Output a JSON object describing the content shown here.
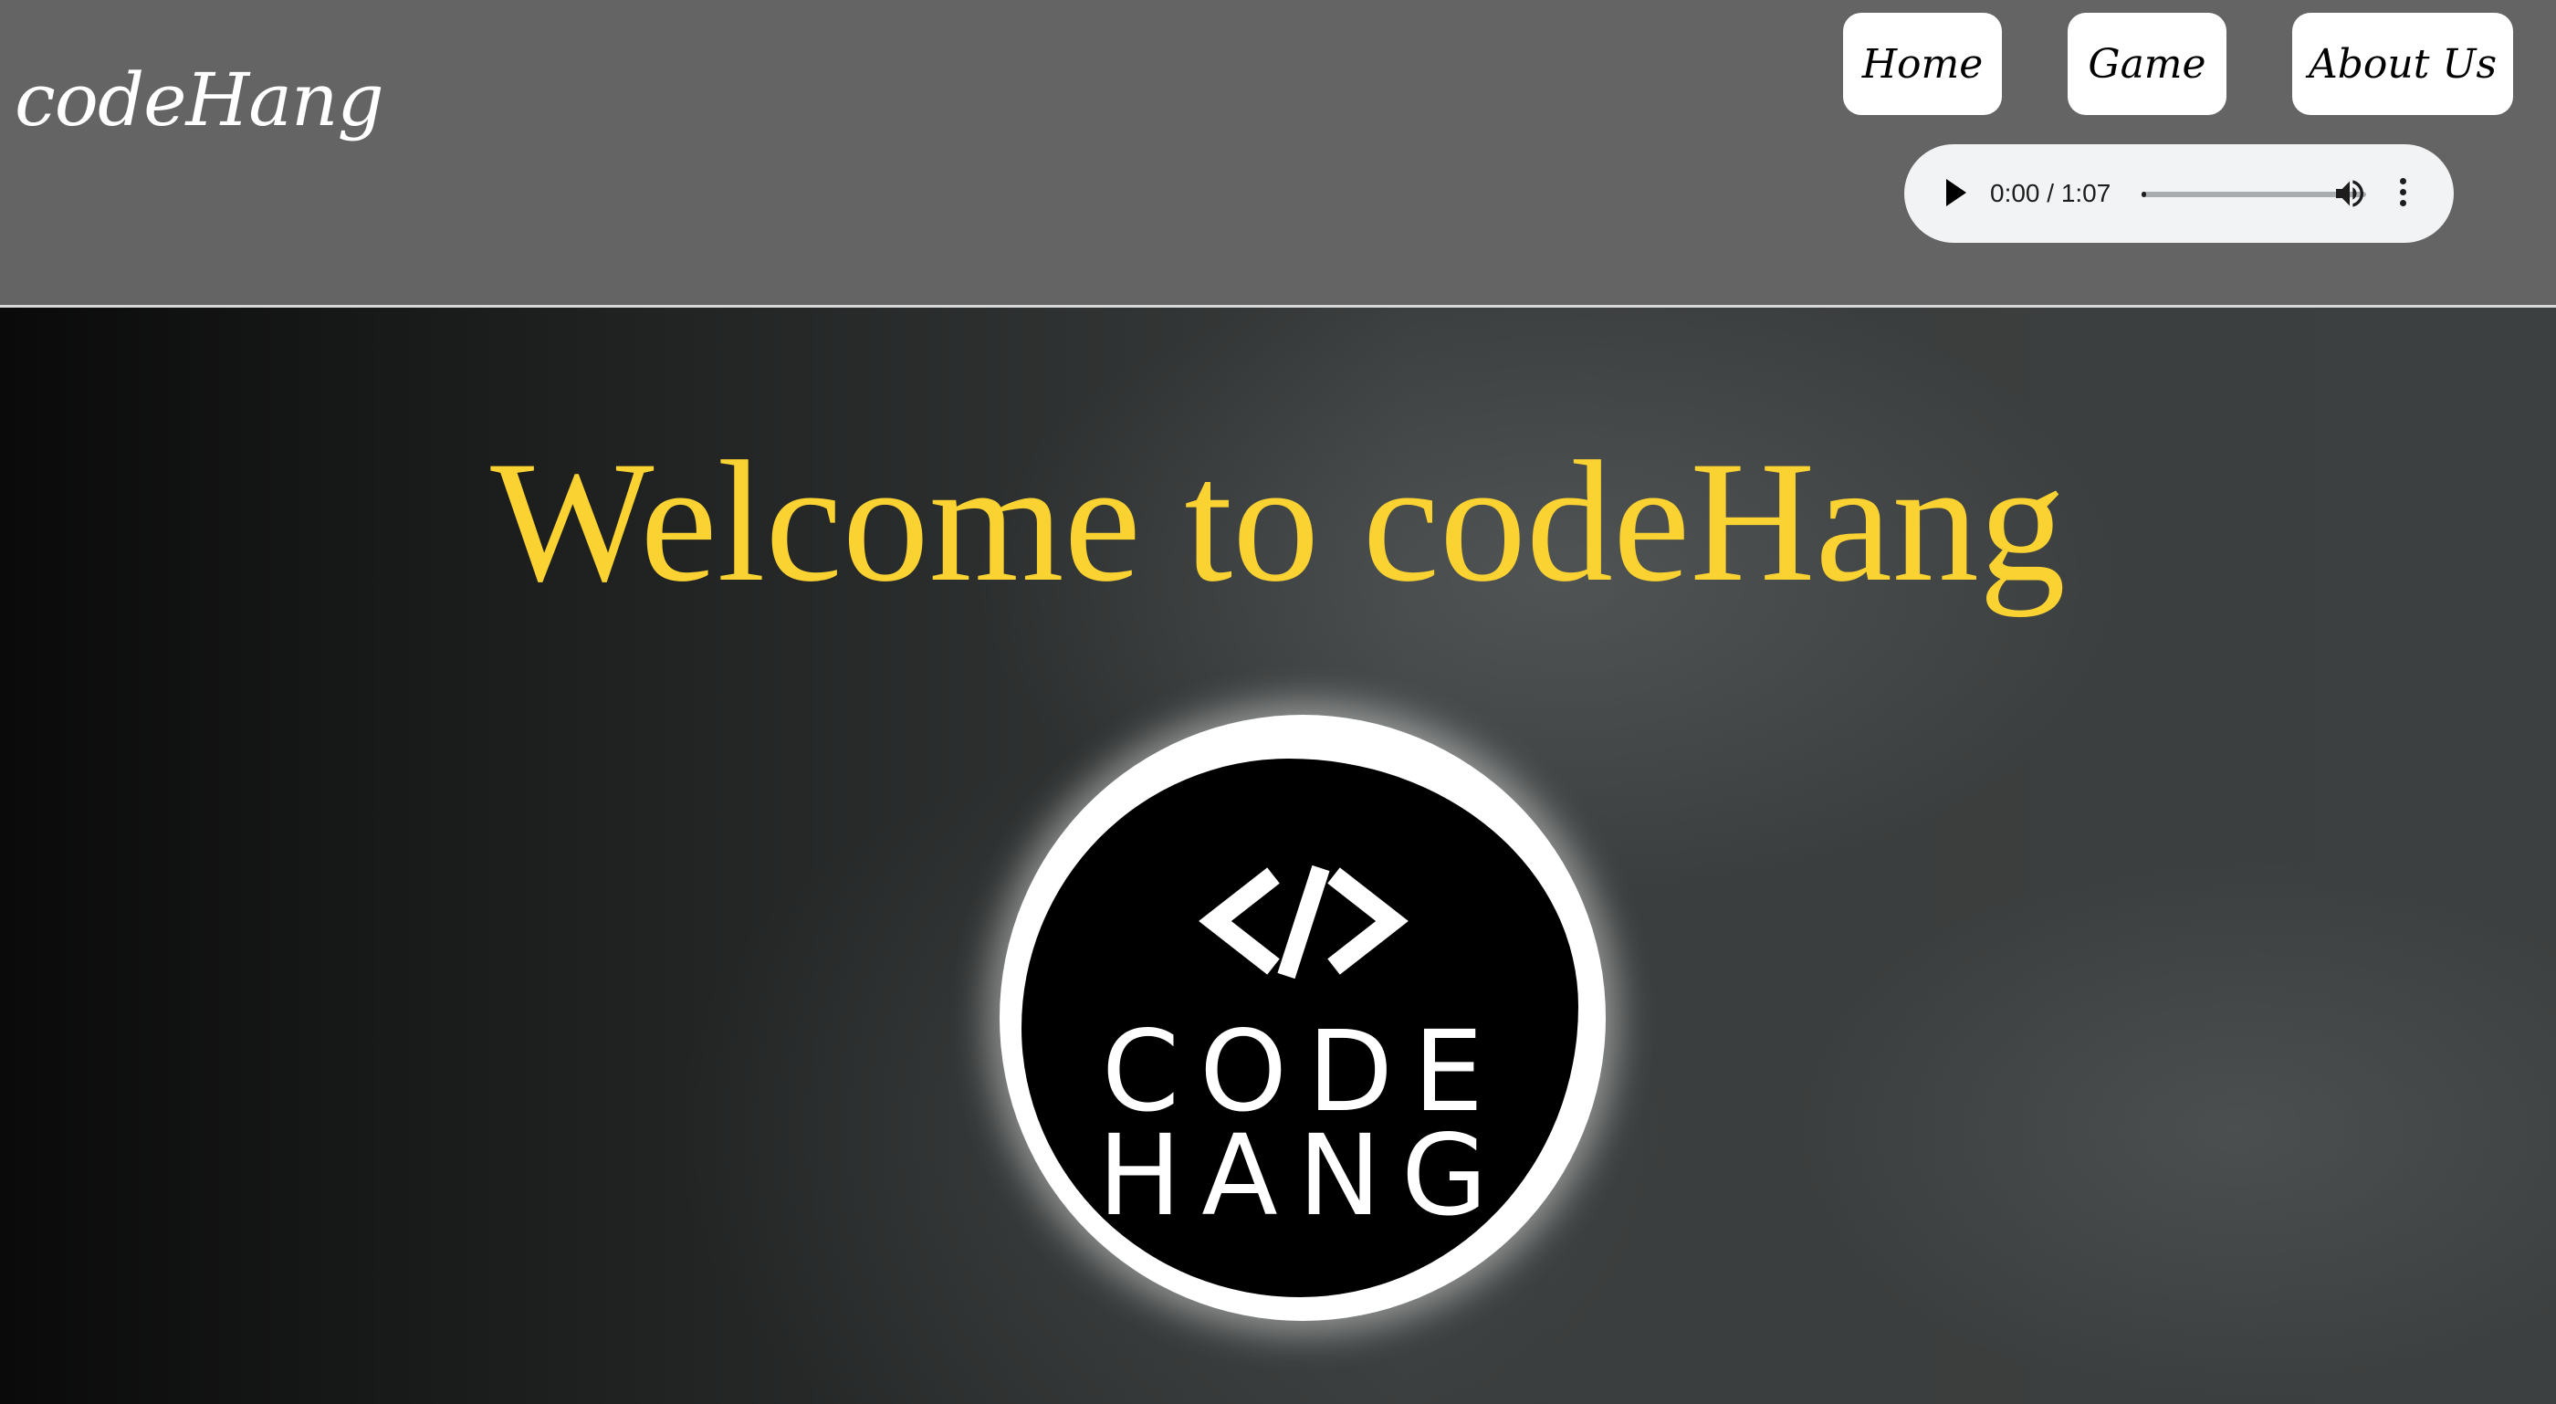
{
  "header": {
    "logo_text": "codeHang",
    "background": "#646464"
  },
  "nav": {
    "items": [
      {
        "label": "Home"
      },
      {
        "label": "Game"
      },
      {
        "label": "About Us"
      }
    ]
  },
  "audio_player": {
    "time_display": "0:00 / 1:07",
    "current_time": "0:00",
    "duration": "1:07",
    "progress_fraction": 0.0,
    "icons": [
      "play-icon",
      "volume-icon",
      "more-options-icon"
    ]
  },
  "hero": {
    "headline": "Welcome to codeHang",
    "headline_color": "#fad231",
    "badge": {
      "symbol": "</>",
      "line1": "CODE",
      "line2": "HANG"
    }
  }
}
